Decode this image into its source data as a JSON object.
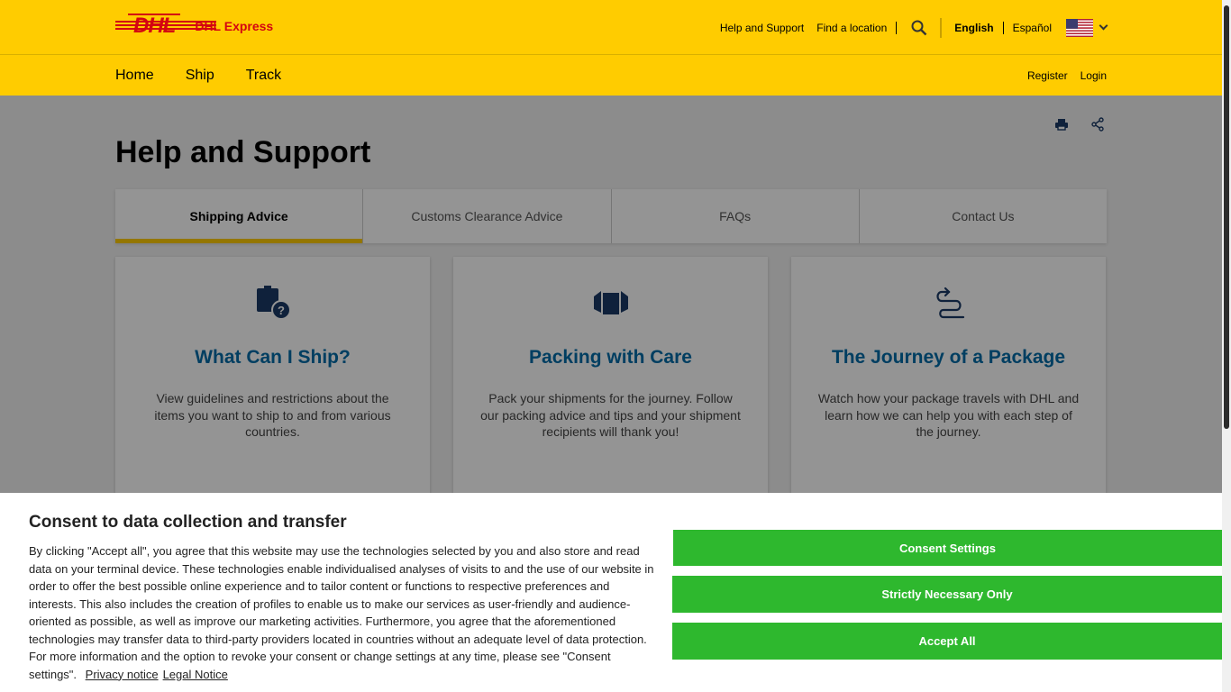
{
  "header": {
    "logo_text": "DHL",
    "logo_subtitle": "DHL Express",
    "links": [
      "Help and Support",
      "Find a location"
    ],
    "languages": [
      "English",
      "Español"
    ]
  },
  "nav": {
    "main": [
      "Home",
      "Ship",
      "Track"
    ],
    "right": [
      "Register",
      "Login"
    ]
  },
  "page": {
    "title": "Help and Support",
    "tabs": [
      "Shipping Advice",
      "Customs Clearance Advice",
      "FAQs",
      "Contact Us"
    ],
    "active_tab": "Shipping Advice"
  },
  "cards": [
    {
      "icon": "package-question-icon",
      "title": "What Can I Ship?",
      "text": "View guidelines and restrictions about the items you want to ship to and from various countries."
    },
    {
      "icon": "open-box-icon",
      "title": "Packing with Care",
      "text": "Pack your shipments for the journey. Follow our packing advice and tips and your shipment recipients will thank you!"
    },
    {
      "icon": "route-icon",
      "title": "The Journey of a Package",
      "text": "Watch how your package travels with DHL and learn how we can help you with each step of the journey."
    }
  ],
  "consent": {
    "title": "Consent to data collection and transfer",
    "text": "By clicking \"Accept all\", you agree that this website may use the technologies selected by you and also store and read data on your terminal device. These technologies enable individualised analyses of visits to and the use of our website in order to offer the best possible online experience and to tailor content or functions to respective preferences and interests. This also includes the creation of profiles to enable us to make our services as user-friendly and audience-oriented as possible, as well as improve our marketing activities.  Furthermore, you agree that the aforementioned technologies may transfer data to third-party providers located in countries without an adequate level of data protection. For more information and the option to revoke your consent or change settings at any time, please see \"Consent settings\".",
    "privacy_link": "Privacy notice",
    "legal_link": "Legal Notice",
    "buttons": [
      "Consent Settings",
      "Strictly Necessary Only",
      "Accept All"
    ]
  },
  "colors": {
    "brand_yellow": "#ffcc00",
    "brand_red": "#d40511",
    "link_blue": "#006ca8",
    "button_green": "#2eb82e"
  }
}
